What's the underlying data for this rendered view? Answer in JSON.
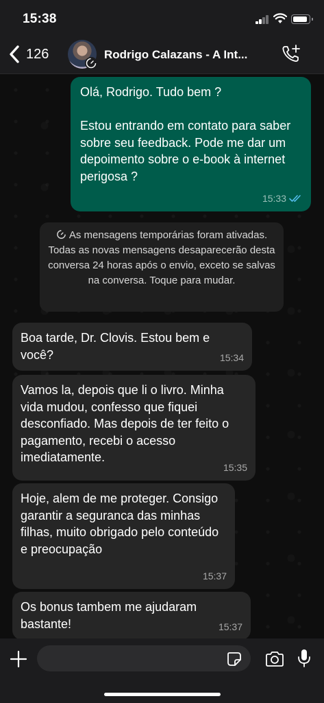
{
  "status_bar": {
    "time": "15:38"
  },
  "header": {
    "back_count": "126",
    "contact_name": "Rodrigo Calazans - A Int..."
  },
  "messages": [
    {
      "direction": "outgoing",
      "text": "Olá, Rodrigo. Tudo bem ?\n\nEstou entrando em contato para saber sobre seu feedback. Pode me dar um depoimento sobre o e-book à internet perigosa ?",
      "time": "15:33",
      "status": "read"
    },
    {
      "direction": "incoming",
      "text": "Boa tarde, Dr. Clovis. Estou bem e você?",
      "time": "15:34"
    },
    {
      "direction": "incoming",
      "text": "Vamos la, depois que li o livro. Minha vida mudou, confesso que fiquei desconfiado. Mas depois de ter feito o pagamento, recebi o acesso imediatamente.",
      "time": "15:35"
    },
    {
      "direction": "incoming",
      "text": "Hoje, alem de me proteger. Consigo garantir a seguranca das minhas filhas, muito obrigado pelo conteúdo e preocupação",
      "time": "15:37"
    },
    {
      "direction": "incoming",
      "text": "Os bonus tambem me ajudaram bastante!",
      "time": "15:37"
    }
  ],
  "system_notice": {
    "text": "As mensagens temporárias foram ativadas. Todas as novas mensagens desaparecerão desta conversa 24 horas após o envio, exceto se salvas na conversa. Toque para mudar."
  },
  "input": {
    "placeholder": ""
  },
  "colors": {
    "outgoing_bubble": "#005c4b",
    "incoming_bubble": "#262626",
    "read_ticks": "#53bdeb"
  },
  "icons": [
    "chevron-left-icon",
    "timer-icon",
    "phone-plus-icon",
    "plus-icon",
    "sticker-icon",
    "camera-icon",
    "microphone-icon"
  ]
}
